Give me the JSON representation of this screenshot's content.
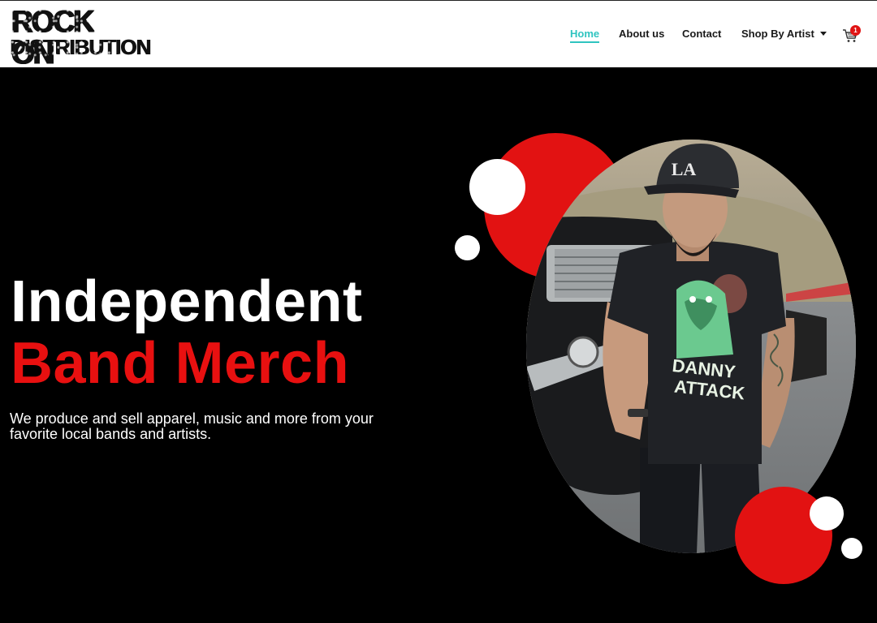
{
  "brand": {
    "logo_line1": "ROCK ON",
    "logo_line2": "DISTRIBUTION"
  },
  "nav": {
    "items": [
      {
        "label": "Home",
        "active": true
      },
      {
        "label": "About us",
        "active": false
      },
      {
        "label": "Contact",
        "active": false
      },
      {
        "label": "Shop By Artist",
        "active": false,
        "dropdown": true
      }
    ],
    "cart_icon": "shopping-cart-icon",
    "cart_count": "1"
  },
  "hero": {
    "title_line1": "Independent",
    "title_line2": "Band Merch",
    "description": "We produce and sell apparel, music and more from your favorite local bands and artists.",
    "image_shirt_text_1": "DANNY",
    "image_shirt_text_2": "ATTACK",
    "image_cap_text": "LA"
  },
  "colors": {
    "accent": "#2fc4c0",
    "brand_red": "#e21212",
    "background": "#000000",
    "header_bg": "#ffffff"
  }
}
